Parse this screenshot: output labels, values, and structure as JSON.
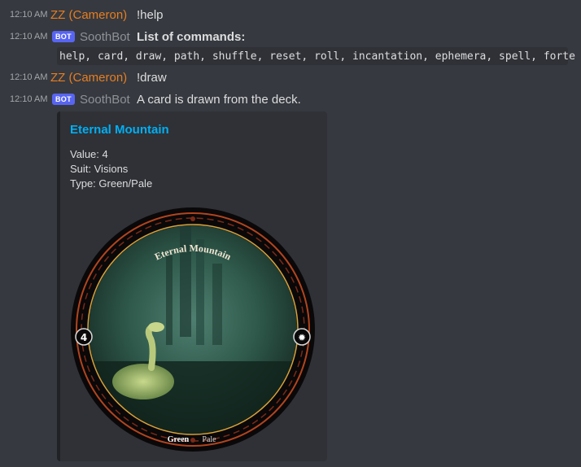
{
  "messages": [
    {
      "time": "12:10 AM",
      "author": "ZZ (Cameron)",
      "text": "!help"
    },
    {
      "time": "12:10 AM",
      "author": "SoothBot",
      "badge": "BOT",
      "title": "List of commands:",
      "commands": "help, card, draw, path, shuffle, reset, roll, incantation, ephemera, spell, forte"
    },
    {
      "time": "12:10 AM",
      "author": "ZZ (Cameron)",
      "text": "!draw"
    },
    {
      "time": "12:10 AM",
      "author": "SoothBot",
      "badge": "BOT",
      "text": "A card is drawn from the deck."
    }
  ],
  "embed": {
    "title": "Eternal Mountain",
    "value": "Value: 4",
    "suit": "Suit: Visions",
    "type": "Type: Green/Pale",
    "card_image": {
      "arc_title": "Eternal Mountain",
      "bottom_left": "Green",
      "bottom_right": "Pale",
      "left_symbol": "4",
      "right_symbol": "sun-icon"
    }
  },
  "colors": {
    "background": "#36393f",
    "user_name": "#e67e22",
    "bot_badge": "#5865f2",
    "embed_title": "#00aff4"
  }
}
